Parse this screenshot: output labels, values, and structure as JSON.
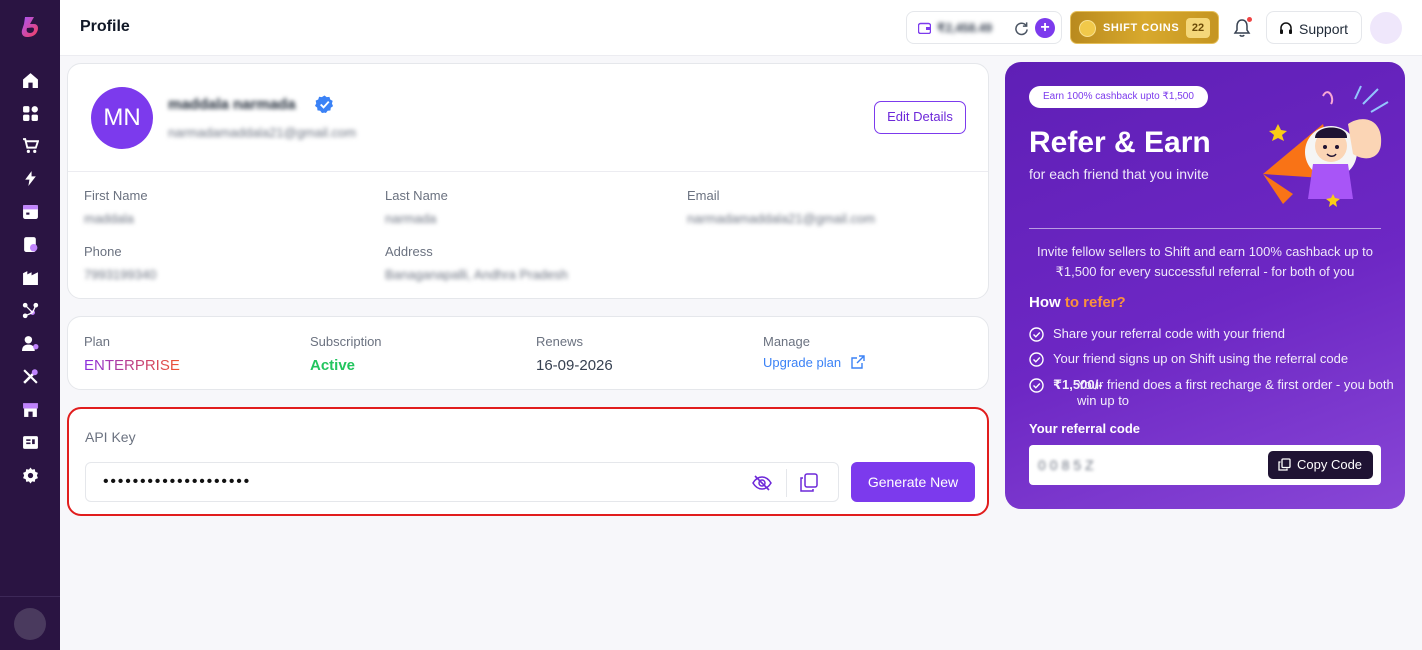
{
  "header": {
    "title": "Profile",
    "wallet_amount": "₹2,458.49",
    "coins_label": "SHIFT COINS",
    "coins_count": "22",
    "support_label": "Support"
  },
  "sidebar": {
    "items": [
      "home-icon",
      "dashboard-icon",
      "cart-icon",
      "bolt-icon",
      "calendar-icon",
      "clipboard-icon",
      "warehouse-icon",
      "network-icon",
      "user-icon",
      "tools-icon",
      "store-icon",
      "invoice-icon",
      "gear-icon"
    ]
  },
  "profile": {
    "initials": "MN",
    "name": "maddala narmada",
    "email": "narmadamaddala21@gmail.com",
    "edit_label": "Edit Details",
    "fields": [
      {
        "label": "First Name",
        "value": "maddala"
      },
      {
        "label": "Last Name",
        "value": "narmada"
      },
      {
        "label": "Email",
        "value": "narmadamaddala21@gmail.com"
      },
      {
        "label": "Phone",
        "value": "7993199340"
      },
      {
        "label": "Address",
        "value": "Banaganapalli, Andhra Pradesh"
      }
    ]
  },
  "plan": {
    "plan_label": "Plan",
    "plan_value": "ENTERPRISE",
    "subscription_label": "Subscription",
    "subscription_value": "Active",
    "renews_label": "Renews",
    "renews_value": "16-09-2026",
    "manage_label": "Manage",
    "manage_link": "Upgrade plan"
  },
  "api": {
    "label": "API Key",
    "masked_value": "••••••••••••••••••••",
    "generate_label": "Generate New"
  },
  "referral": {
    "pill": "Earn 100% cashback upto ₹1,500",
    "title": "Refer & Earn",
    "subtitle": "for each friend that you invite",
    "description": "Invite fellow sellers to Shift and earn 100% cashback up to ₹1,500 for every successful referral - for both of you",
    "how_prefix": "How",
    "how_accent": " to refer?",
    "steps": [
      "Share your referral code with your friend",
      "Your friend signs up on Shift using the referral code",
      "Your friend does a first recharge & first order - you both win up to "
    ],
    "step3_bold": "₹1,500/-",
    "code_label": "Your referral code",
    "code_value": "0085Z",
    "copy_label": "Copy Code"
  },
  "colors": {
    "sidebar": "#2a1442",
    "accent": "#7c3aed",
    "active": "#22c55e",
    "link": "#3b82f6",
    "highlight_border": "#e11d1d"
  }
}
